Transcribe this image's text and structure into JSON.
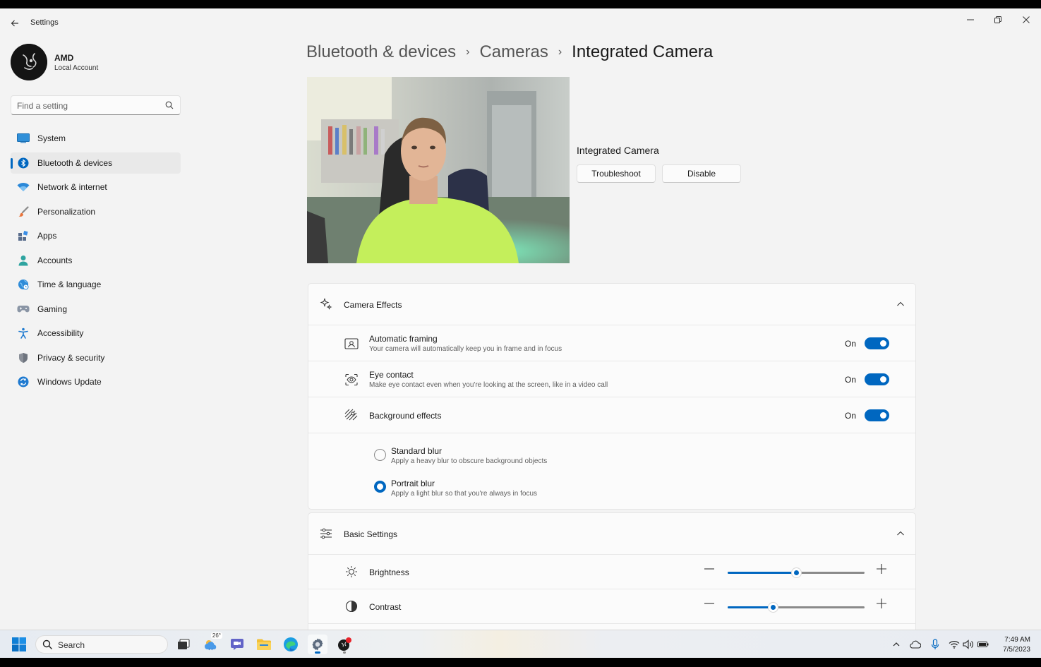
{
  "window": {
    "app_title": "Settings",
    "back_icon": "back-arrow-icon",
    "minimize_icon": "minimize-icon",
    "maximize_icon": "restore-icon",
    "close_icon": "close-icon"
  },
  "profile": {
    "name": "AMD",
    "account_type": "Local Account"
  },
  "search": {
    "placeholder": "Find a setting",
    "value": ""
  },
  "sidebar": {
    "items": [
      {
        "label": "System",
        "icon": "system-icon",
        "active": false
      },
      {
        "label": "Bluetooth & devices",
        "icon": "bluetooth-icon",
        "active": true
      },
      {
        "label": "Network & internet",
        "icon": "wifi-icon",
        "active": false
      },
      {
        "label": "Personalization",
        "icon": "brush-icon",
        "active": false
      },
      {
        "label": "Apps",
        "icon": "apps-icon",
        "active": false
      },
      {
        "label": "Accounts",
        "icon": "person-icon",
        "active": false
      },
      {
        "label": "Time & language",
        "icon": "globe-clock-icon",
        "active": false
      },
      {
        "label": "Gaming",
        "icon": "gamepad-icon",
        "active": false
      },
      {
        "label": "Accessibility",
        "icon": "accessibility-icon",
        "active": false
      },
      {
        "label": "Privacy & security",
        "icon": "shield-icon",
        "active": false
      },
      {
        "label": "Windows Update",
        "icon": "update-icon",
        "active": false
      }
    ]
  },
  "breadcrumb": {
    "items": [
      "Bluetooth & devices",
      "Cameras"
    ],
    "current": "Integrated Camera"
  },
  "camera": {
    "name": "Integrated Camera",
    "troubleshoot_label": "Troubleshoot",
    "disable_label": "Disable"
  },
  "camera_effects": {
    "title": "Camera Effects",
    "automatic_framing": {
      "title": "Automatic framing",
      "description": "Your camera will automatically keep you in frame and in focus",
      "state": "On"
    },
    "eye_contact": {
      "title": "Eye contact",
      "description": "Make eye contact even when you're looking at the screen, like in a video call",
      "state": "On"
    },
    "background_effects": {
      "title": "Background effects",
      "state": "On",
      "options": [
        {
          "title": "Standard blur",
          "description": "Apply a heavy blur to obscure background objects",
          "selected": false
        },
        {
          "title": "Portrait blur",
          "description": "Apply a light blur so that you're always in focus",
          "selected": true
        }
      ]
    }
  },
  "basic_settings": {
    "title": "Basic Settings",
    "brightness": {
      "title": "Brightness",
      "level_fraction": 0.5
    },
    "contrast": {
      "title": "Contrast",
      "level_fraction": 0.33
    }
  },
  "taskbar": {
    "search_label": "Search",
    "weather_temp": "26°",
    "time": "7:49 AM",
    "date": "7/5/2023"
  },
  "colors": {
    "accent": "#0067c0",
    "background": "#f3f3f3",
    "card": "#fbfbfb"
  }
}
